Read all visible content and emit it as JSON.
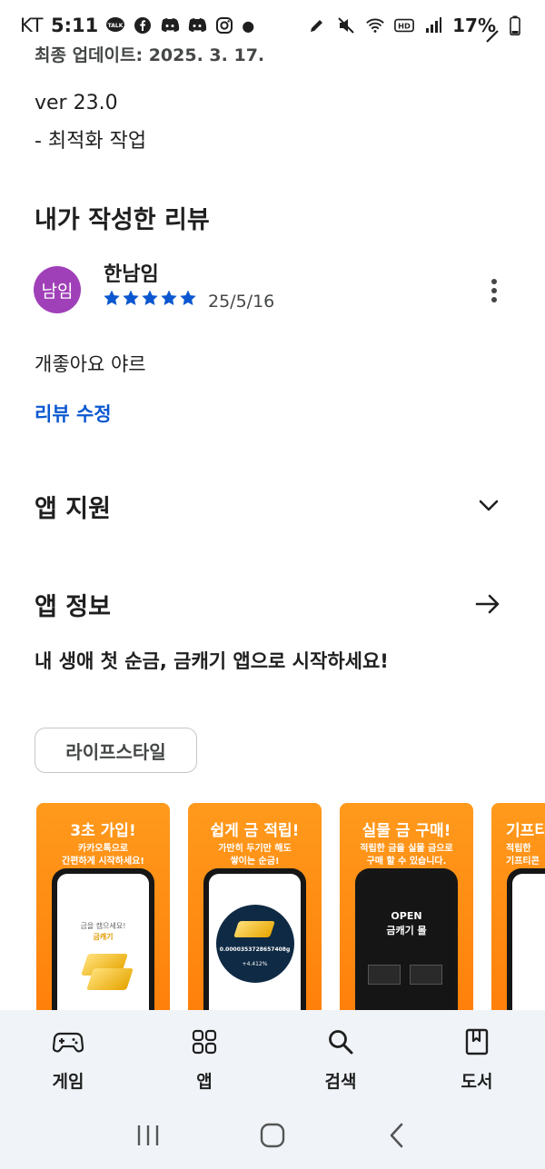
{
  "status_bar": {
    "carrier": "KT",
    "time": "5:11",
    "battery": "17%"
  },
  "details": {
    "last_updated": "최종 업데이트: 2025. 3. 17.",
    "version": "ver 23.0",
    "version_note": "- 최적화 작업"
  },
  "my_review": {
    "title": "내가 작성한 리뷰",
    "avatar_text": "남임",
    "avatar_color": "#a040b8",
    "reviewer_name": "한남임",
    "rating_stars": 5,
    "date": "25/5/16",
    "text": "개좋아요 야르",
    "edit_label": "리뷰 수정"
  },
  "sections": {
    "app_support": "앱 지원",
    "app_info": "앱 정보"
  },
  "app_description": "내 생애 첫 순금, 금캐기 앱으로 시작하세요!",
  "category_chip": "라이프스타일",
  "screenshots": [
    {
      "title": "3초 가입!",
      "subtitle_1": "카카오톡으로",
      "subtitle_2": "간편하게 시작하세요!",
      "screen_line_1": "금을 캠으세요!",
      "screen_line_2": "금캐기"
    },
    {
      "title": "쉽게 금 적립!",
      "subtitle_1": "가만히 두기만 해도",
      "subtitle_2": "쌓이는 순금!",
      "screen_value": "0.0000353728657408g",
      "screen_delta": "+4.412%"
    },
    {
      "title": "실물 금 구매!",
      "subtitle_1": "적립한 금을 실물 금으로",
      "subtitle_2": "구매 할 수 있습니다.",
      "screen_line_1": "OPEN",
      "screen_line_2": "금캐기 몰"
    },
    {
      "title": "기프티",
      "subtitle_1": "적립한",
      "subtitle_2": "기프티콘"
    }
  ],
  "bottom_nav": [
    {
      "label": "게임",
      "icon": "gamepad-icon"
    },
    {
      "label": "앱",
      "icon": "apps-grid-icon"
    },
    {
      "label": "검색",
      "icon": "search-icon"
    },
    {
      "label": "도서",
      "icon": "book-icon"
    }
  ],
  "colors": {
    "accent_blue": "#0b57d0",
    "star_blue": "#0b57d0",
    "screenshot_orange": "#ff8a12",
    "nav_background": "#f0f4f9"
  }
}
